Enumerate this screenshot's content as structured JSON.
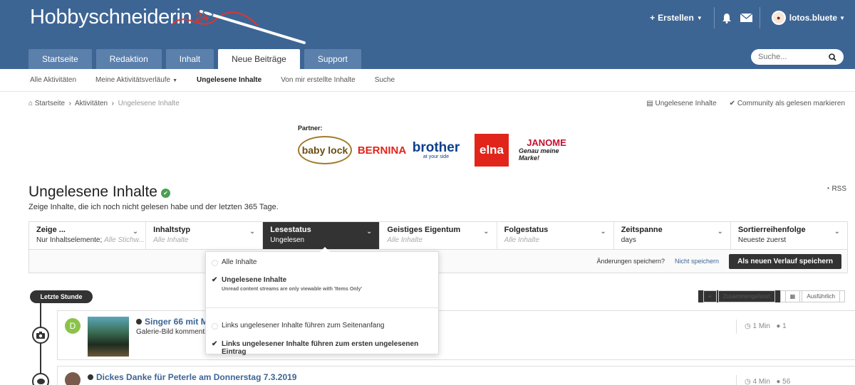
{
  "header": {
    "logo_text": "Hobbyschneiderin",
    "logo_sup": "24",
    "create_label": "Erstellen",
    "username": "lotos.bluete",
    "tabs": [
      {
        "label": "Startseite"
      },
      {
        "label": "Redaktion"
      },
      {
        "label": "Inhalt"
      },
      {
        "label": "Neue Beiträge"
      },
      {
        "label": "Support"
      }
    ],
    "search_placeholder": "Suche..."
  },
  "subnav": {
    "items": [
      {
        "label": "Alle Aktivitäten"
      },
      {
        "label": "Meine Aktivitätsverläufe"
      },
      {
        "label": "Ungelesene Inhalte"
      },
      {
        "label": "Von mir erstellte Inhalte"
      },
      {
        "label": "Suche"
      }
    ]
  },
  "breadcrumb": {
    "items": [
      "Startseite",
      "Aktivitäten",
      "Ungelesene Inhalte"
    ],
    "actions": [
      "Ungelesene Inhalte",
      "Community als gelesen markieren"
    ]
  },
  "partners": {
    "label": "Partner:",
    "logos": [
      "baby lock",
      "BERNINA",
      "brother",
      "at your side",
      "elna",
      "JANOME",
      "Genau meine Marke!"
    ]
  },
  "page": {
    "title": "Ungelesene Inhalte",
    "subtitle": "Zeige Inhalte, die ich noch nicht gelesen habe und der letzten 365 Tage.",
    "rss": "RSS"
  },
  "filters": [
    {
      "title": "Zeige ...",
      "value": "Nur Inhaltselemente;",
      "hint": "Alle Stichw..."
    },
    {
      "title": "Inhaltstyp",
      "value": "",
      "hint": "Alle Inhalte"
    },
    {
      "title": "Lesestatus",
      "value": "Ungelesen",
      "hint": ""
    },
    {
      "title": "Geistiges Eigentum",
      "value": "",
      "hint": "Alle Inhalte"
    },
    {
      "title": "Folgestatus",
      "value": "",
      "hint": "Alle Inhalte"
    },
    {
      "title": "Zeitspanne",
      "value": "days",
      "hint": ""
    },
    {
      "title": "Sortierreihenfolge",
      "value": "Neueste zuerst",
      "hint": ""
    }
  ],
  "filter_actions": {
    "question": "Änderungen speichern?",
    "dont_save": "Nicht speichern",
    "save_new": "Als neuen Verlauf speichern"
  },
  "dropdown": {
    "items": [
      {
        "label": "Alle Inhalte"
      },
      {
        "label": "Ungelesene Inhalte",
        "desc": "Unread content streams are only viewable with 'Items Only'"
      },
      {
        "label": "Links ungelesener Inhalte führen zum Seitenanfang"
      },
      {
        "label": "Links ungelesener Inhalte führen zum ersten ungelesenen Eintrag"
      }
    ]
  },
  "timeline": {
    "badge": "Letzte Stunde",
    "view_condensed": "Zusammengefasst",
    "view_expanded": "Ausführlich"
  },
  "stream": [
    {
      "avatar_letter": "D",
      "title": "Singer 66 mit Mo",
      "subtitle": "Galerie-Bild kommenti",
      "time": "1 Min",
      "replies": "1"
    },
    {
      "title": "Dickes Danke für Peterle am Donnerstag 7.3.2019",
      "time": "4 Min",
      "replies": "56"
    }
  ]
}
